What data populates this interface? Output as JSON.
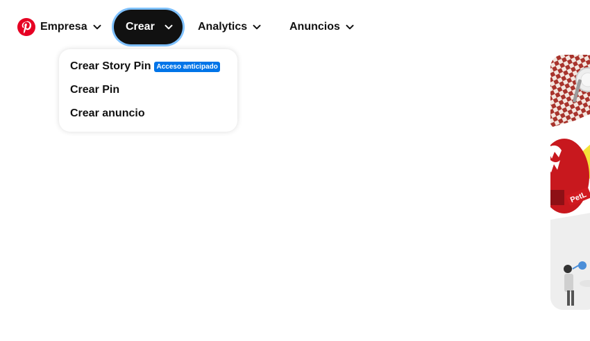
{
  "nav": {
    "empresa": "Empresa",
    "crear": "Crear",
    "analytics": "Analytics",
    "anuncios": "Anuncios"
  },
  "dropdown": {
    "items": [
      {
        "label": "Crear Story Pin",
        "badge": "Acceso anticipado"
      },
      {
        "label": "Crear Pin"
      },
      {
        "label": "Crear anuncio"
      }
    ]
  },
  "art": {
    "tag_text": "PetL"
  },
  "colors": {
    "brand": "#e60023",
    "active_nav_bg": "#111111",
    "focus_ring": "#7fc1ff",
    "badge_bg": "#0074e8"
  }
}
